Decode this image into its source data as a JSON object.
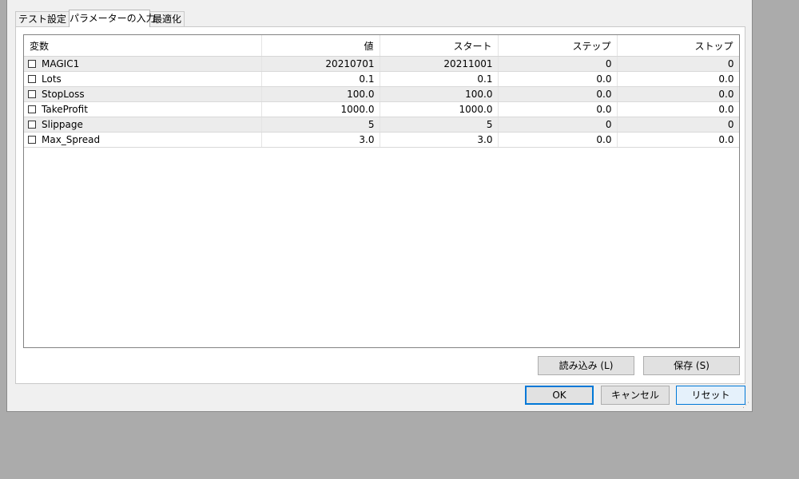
{
  "tabs": [
    {
      "label": "テスト設定"
    },
    {
      "label": "パラメーターの入力"
    },
    {
      "label": "最適化"
    }
  ],
  "columns": [
    "変数",
    "値",
    "スタート",
    "ステップ",
    "ストップ"
  ],
  "rows": [
    {
      "name": "MAGIC1",
      "value": "20210701",
      "start": "20211001",
      "step": "0",
      "stop": "0",
      "checked": false
    },
    {
      "name": "Lots",
      "value": "0.1",
      "start": "0.1",
      "step": "0.0",
      "stop": "0.0",
      "checked": false
    },
    {
      "name": "StopLoss",
      "value": "100.0",
      "start": "100.0",
      "step": "0.0",
      "stop": "0.0",
      "checked": false
    },
    {
      "name": "TakeProfit",
      "value": "1000.0",
      "start": "1000.0",
      "step": "0.0",
      "stop": "0.0",
      "checked": false
    },
    {
      "name": "Slippage",
      "value": "5",
      "start": "5",
      "step": "0",
      "stop": "0",
      "checked": false
    },
    {
      "name": "Max_Spread",
      "value": "3.0",
      "start": "3.0",
      "step": "0.0",
      "stop": "0.0",
      "checked": false
    }
  ],
  "buttons": {
    "load": "読み込み (L)",
    "save": "保存 (S)",
    "ok": "OK",
    "cancel": "キャンセル",
    "reset": "リセット"
  },
  "colors": {
    "accent": "#0078d7",
    "row_alt": "#ececec",
    "background": "#ababab"
  }
}
